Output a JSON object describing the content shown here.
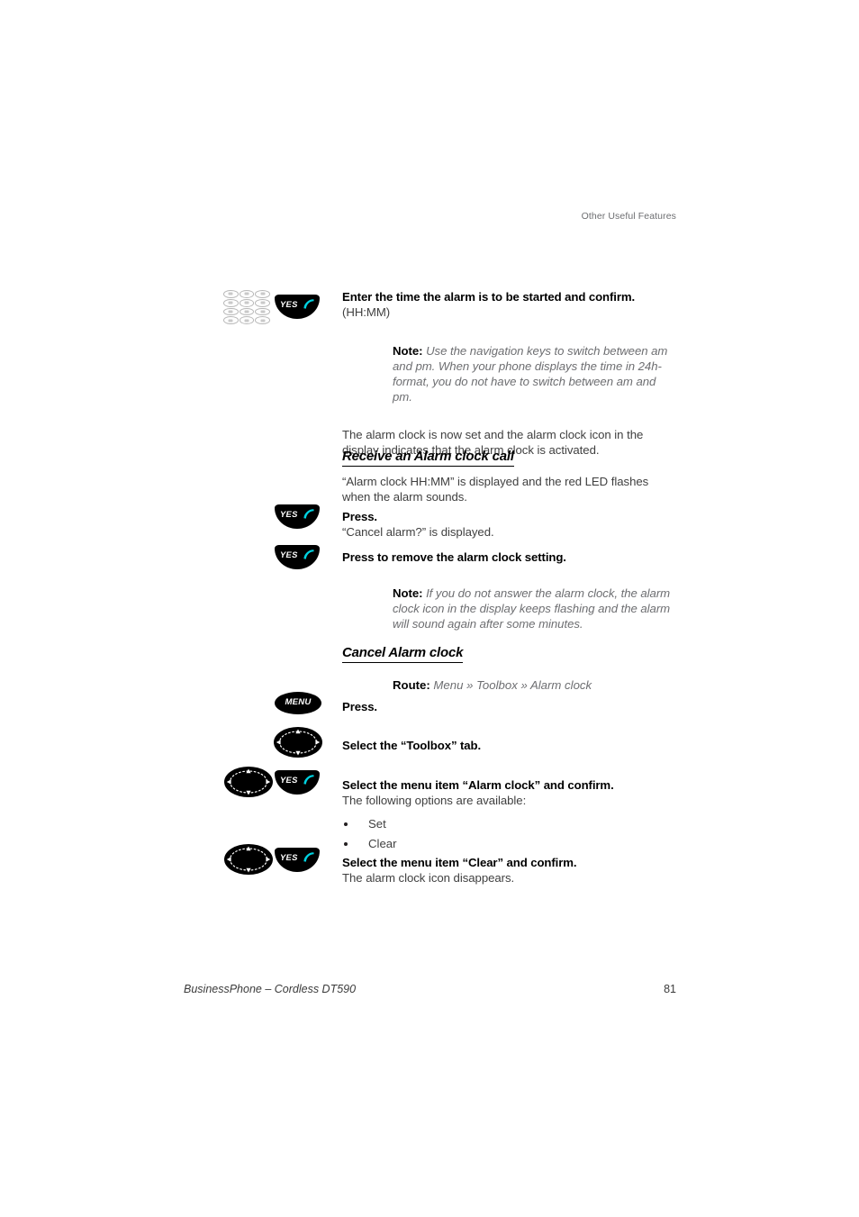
{
  "page": {
    "header": "Other Useful Features",
    "footer_title": "BusinessPhone – Cordless DT590",
    "footer_page": "81"
  },
  "sections": {
    "enter_time": {
      "bold": "Enter the time the alarm is to be started and confirm.",
      "sub": "(HH:MM)",
      "note_label": "Note:",
      "note_text": " Use the navigation keys to switch between am and pm. When your phone displays the time in 24h-format, you do not have to switch between am and pm.",
      "after": "The alarm clock is now set and the alarm clock icon in the display indicates that the alarm clock is activated."
    },
    "receive_call": {
      "heading": "Receive an Alarm clock call",
      "intro": "“Alarm clock HH:MM” is displayed and the red LED flashes when the alarm sounds.",
      "press_bold": "Press.",
      "press_sub": "“Cancel alarm?” is displayed.",
      "remove_bold": "Press to remove the alarm clock setting.",
      "note_label": "Note:",
      "note_text": " If you do not answer the alarm clock, the alarm clock icon in the display keeps flashing and the alarm will sound again after some minutes."
    },
    "cancel_alarm": {
      "heading": "Cancel Alarm clock",
      "route_label": "Route:",
      "route_text": " Menu » Toolbox » Alarm clock",
      "press_bold": "Press.",
      "select_tab_bold": "Select the “Toolbox” tab.",
      "select_item_bold": "Select the menu item “Alarm clock” and confirm.",
      "select_item_sub": "The following options are available:",
      "options": [
        "Set",
        "Clear"
      ],
      "select_clear_bold": "Select the menu item “Clear” and confirm.",
      "select_clear_sub": "The alarm clock icon disappears."
    }
  },
  "icons": {
    "yes_label": "YES",
    "menu_label": "MENU",
    "handset_color": "#00d2e0"
  }
}
